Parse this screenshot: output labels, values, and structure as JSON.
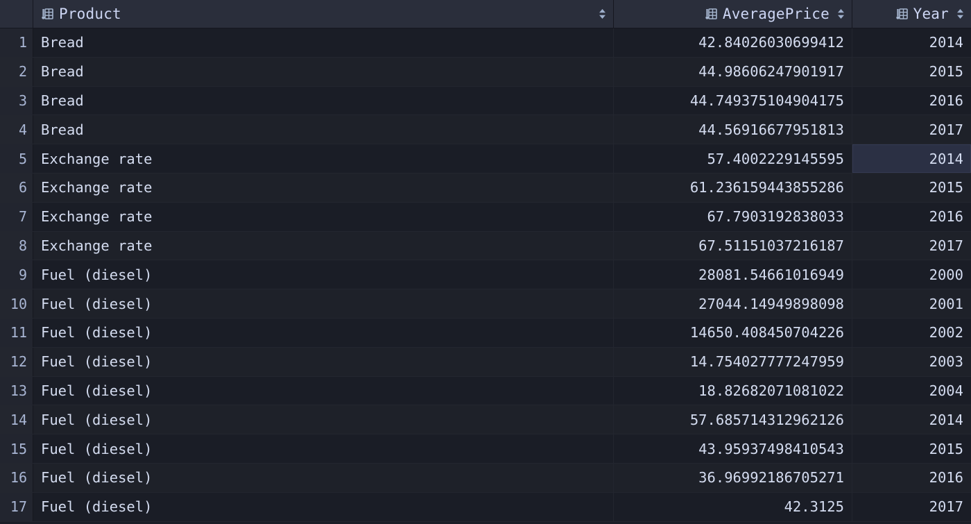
{
  "theme": {
    "background": "#1b1e27",
    "header_bg": "#2a2e3b",
    "row_odd_bg": "#1a1d26",
    "row_even_bg": "#1e2129",
    "gutter_bg": "#22252f",
    "text": "#d4dcf0",
    "header_text": "#cdd6f4",
    "gutter_text": "#a9b6d4",
    "selection_bg": "#2b3044",
    "icon_color": "#a6b6cf",
    "grid_line": "#23262f"
  },
  "table": {
    "columns": [
      {
        "key": "product",
        "label": "Product",
        "icon": "table-column-icon",
        "sort_icon": "sort-arrows-icon",
        "align": "left"
      },
      {
        "key": "averageprice",
        "label": "AveragePrice",
        "icon": "table-column-icon",
        "sort_icon": "sort-arrows-icon",
        "align": "right"
      },
      {
        "key": "year",
        "label": "Year",
        "icon": "table-column-icon",
        "sort_icon": "sort-arrows-icon",
        "align": "right"
      }
    ],
    "selected_cell": {
      "row": 5,
      "column": "year"
    },
    "rows": [
      {
        "num": "1",
        "product": "Bread",
        "averageprice": "42.84026030699412",
        "year": "2014"
      },
      {
        "num": "2",
        "product": "Bread",
        "averageprice": "44.98606247901917",
        "year": "2015"
      },
      {
        "num": "3",
        "product": "Bread",
        "averageprice": "44.749375104904175",
        "year": "2016"
      },
      {
        "num": "4",
        "product": "Bread",
        "averageprice": "44.56916677951813",
        "year": "2017"
      },
      {
        "num": "5",
        "product": "Exchange rate",
        "averageprice": "57.4002229145595",
        "year": "2014"
      },
      {
        "num": "6",
        "product": "Exchange rate",
        "averageprice": "61.236159443855286",
        "year": "2015"
      },
      {
        "num": "7",
        "product": "Exchange rate",
        "averageprice": "67.7903192838033",
        "year": "2016"
      },
      {
        "num": "8",
        "product": "Exchange rate",
        "averageprice": "67.51151037216187",
        "year": "2017"
      },
      {
        "num": "9",
        "product": "Fuel (diesel)",
        "averageprice": "28081.54661016949",
        "year": "2000"
      },
      {
        "num": "10",
        "product": "Fuel (diesel)",
        "averageprice": "27044.14949898098",
        "year": "2001"
      },
      {
        "num": "11",
        "product": "Fuel (diesel)",
        "averageprice": "14650.408450704226",
        "year": "2002"
      },
      {
        "num": "12",
        "product": "Fuel (diesel)",
        "averageprice": "14.754027777247959",
        "year": "2003"
      },
      {
        "num": "13",
        "product": "Fuel (diesel)",
        "averageprice": "18.82682071081022",
        "year": "2004"
      },
      {
        "num": "14",
        "product": "Fuel (diesel)",
        "averageprice": "57.685714312962126",
        "year": "2014"
      },
      {
        "num": "15",
        "product": "Fuel (diesel)",
        "averageprice": "43.95937498410543",
        "year": "2015"
      },
      {
        "num": "16",
        "product": "Fuel (diesel)",
        "averageprice": "36.96992186705271",
        "year": "2016"
      },
      {
        "num": "17",
        "product": "Fuel (diesel)",
        "averageprice": "42.3125",
        "year": "2017"
      }
    ]
  }
}
